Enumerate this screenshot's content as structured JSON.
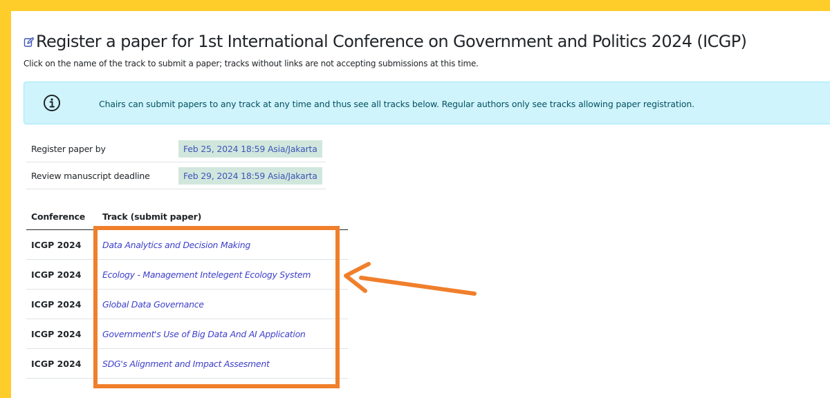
{
  "page": {
    "title": "Register a paper for 1st International Conference on Government and Politics 2024 (ICGP)",
    "subtitle": "Click on the name of the track to submit a paper; tracks without links are not accepting submissions at this time.",
    "edit_icon": "edit-icon"
  },
  "alert": {
    "icon": "info-icon",
    "text": "Chairs can submit papers to any track at any time and thus see all tracks below. Regular authors only see tracks allowing paper registration."
  },
  "deadlines": [
    {
      "label": "Register paper by",
      "value": "Feb 25, 2024 18:59 Asia/Jakarta"
    },
    {
      "label": "Review manuscript deadline",
      "value": "Feb 29, 2024 18:59 Asia/Jakarta"
    }
  ],
  "tracks_table": {
    "headers": {
      "conference": "Conference",
      "track": "Track (submit paper)"
    },
    "rows": [
      {
        "conference": "ICGP 2024",
        "track": "Data Analytics and Decision Making"
      },
      {
        "conference": "ICGP 2024",
        "track": "Ecology - Management Intelegent Ecology System"
      },
      {
        "conference": "ICGP 2024",
        "track": "Global Data Governance"
      },
      {
        "conference": "ICGP 2024",
        "track": "Government's Use of Big Data And AI Application"
      },
      {
        "conference": "ICGP 2024",
        "track": "SDG's Alignment and Impact Assesment"
      }
    ]
  },
  "colors": {
    "frame": "#ffcd29",
    "alert_bg": "#cff4fc",
    "date_bg": "#d1e7dd",
    "link": "#3d3fc9",
    "annotation": "#f07f2c"
  }
}
